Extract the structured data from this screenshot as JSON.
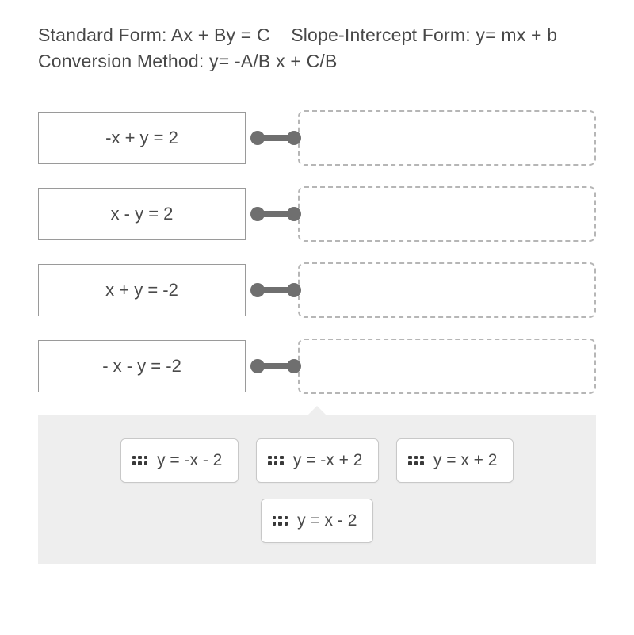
{
  "instructions": {
    "seg1": "Standard Form: Ax + By = C",
    "seg2": "Slope-Intercept Form:  y=",
    "seg3": "mx + b",
    "seg4": "Conversion Method:   y= -A/B x + C/B"
  },
  "prompts": [
    {
      "label": "-x + y = 2"
    },
    {
      "label": "x - y = 2"
    },
    {
      "label": "x + y = -2"
    },
    {
      "label": "- x - y = -2"
    }
  ],
  "choices": [
    {
      "label": "y = -x - 2"
    },
    {
      "label": "y = -x + 2"
    },
    {
      "label": "y = x + 2"
    },
    {
      "label": "y = x - 2"
    }
  ]
}
